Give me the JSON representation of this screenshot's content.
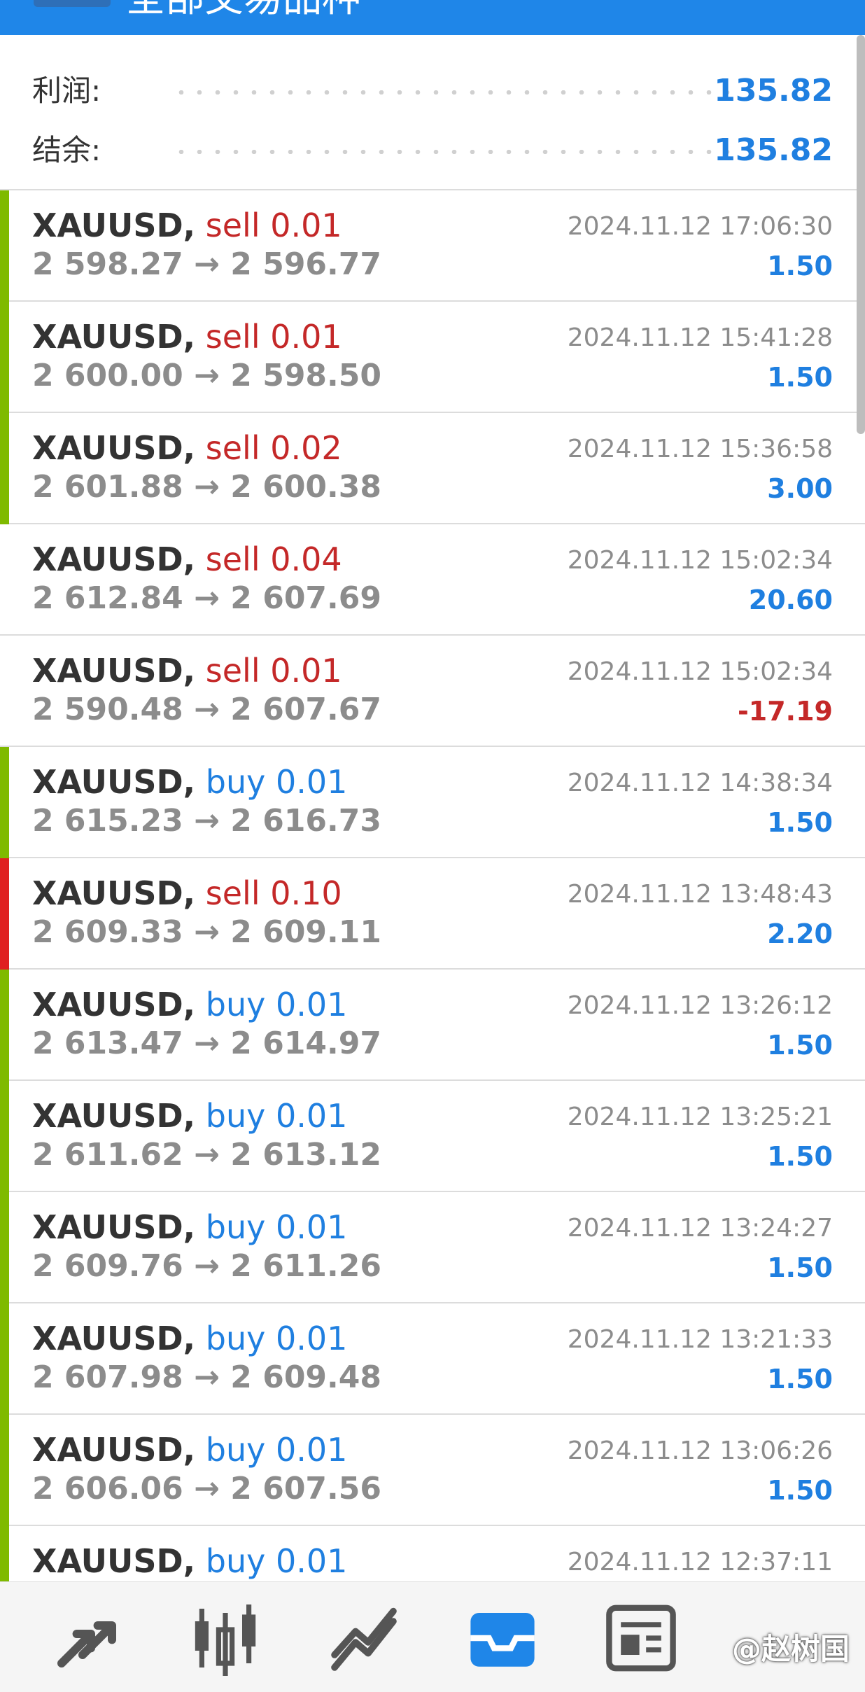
{
  "header": {
    "title": "全部交易品种"
  },
  "summary": {
    "profit_label": "利润:",
    "profit_value": "135.82",
    "balance_label": "结余:",
    "balance_value": "135.82"
  },
  "trades": [
    {
      "symbol": "XAUUSD,",
      "side": "sell",
      "lots": "0.01",
      "open": "2 598.27",
      "arrow": "→",
      "close": "2 596.77",
      "time": "2024.11.12 17:06:30",
      "profit": "1.50",
      "bar_color": "#7fba00",
      "profit_sign": "pos"
    },
    {
      "symbol": "XAUUSD,",
      "side": "sell",
      "lots": "0.01",
      "open": "2 600.00",
      "arrow": "→",
      "close": "2 598.50",
      "time": "2024.11.12 15:41:28",
      "profit": "1.50",
      "bar_color": "#7fba00",
      "profit_sign": "pos"
    },
    {
      "symbol": "XAUUSD,",
      "side": "sell",
      "lots": "0.02",
      "open": "2 601.88",
      "arrow": "→",
      "close": "2 600.38",
      "time": "2024.11.12 15:36:58",
      "profit": "3.00",
      "bar_color": "#7fba00",
      "profit_sign": "pos"
    },
    {
      "symbol": "XAUUSD,",
      "side": "sell",
      "lots": "0.04",
      "open": "2 612.84",
      "arrow": "→",
      "close": "2 607.69",
      "time": "2024.11.12 15:02:34",
      "profit": "20.60",
      "bar_color": "",
      "profit_sign": "pos"
    },
    {
      "symbol": "XAUUSD,",
      "side": "sell",
      "lots": "0.01",
      "open": "2 590.48",
      "arrow": "→",
      "close": "2 607.67",
      "time": "2024.11.12 15:02:34",
      "profit": "-17.19",
      "bar_color": "",
      "profit_sign": "neg"
    },
    {
      "symbol": "XAUUSD,",
      "side": "buy",
      "lots": "0.01",
      "open": "2 615.23",
      "arrow": "→",
      "close": "2 616.73",
      "time": "2024.11.12 14:38:34",
      "profit": "1.50",
      "bar_color": "#7fba00",
      "profit_sign": "pos"
    },
    {
      "symbol": "XAUUSD,",
      "side": "sell",
      "lots": "0.10",
      "open": "2 609.33",
      "arrow": "→",
      "close": "2 609.11",
      "time": "2024.11.12 13:48:43",
      "profit": "2.20",
      "bar_color": "#e02020",
      "profit_sign": "pos"
    },
    {
      "symbol": "XAUUSD,",
      "side": "buy",
      "lots": "0.01",
      "open": "2 613.47",
      "arrow": "→",
      "close": "2 614.97",
      "time": "2024.11.12 13:26:12",
      "profit": "1.50",
      "bar_color": "#7fba00",
      "profit_sign": "pos"
    },
    {
      "symbol": "XAUUSD,",
      "side": "buy",
      "lots": "0.01",
      "open": "2 611.62",
      "arrow": "→",
      "close": "2 613.12",
      "time": "2024.11.12 13:25:21",
      "profit": "1.50",
      "bar_color": "#7fba00",
      "profit_sign": "pos"
    },
    {
      "symbol": "XAUUSD,",
      "side": "buy",
      "lots": "0.01",
      "open": "2 609.76",
      "arrow": "→",
      "close": "2 611.26",
      "time": "2024.11.12 13:24:27",
      "profit": "1.50",
      "bar_color": "#7fba00",
      "profit_sign": "pos"
    },
    {
      "symbol": "XAUUSD,",
      "side": "buy",
      "lots": "0.01",
      "open": "2 607.98",
      "arrow": "→",
      "close": "2 609.48",
      "time": "2024.11.12 13:21:33",
      "profit": "1.50",
      "bar_color": "#7fba00",
      "profit_sign": "pos"
    },
    {
      "symbol": "XAUUSD,",
      "side": "buy",
      "lots": "0.01",
      "open": "2 606.06",
      "arrow": "→",
      "close": "2 607.56",
      "time": "2024.11.12 13:06:26",
      "profit": "1.50",
      "bar_color": "#7fba00",
      "profit_sign": "pos"
    },
    {
      "symbol": "XAUUSD,",
      "side": "buy",
      "lots": "0.01",
      "open": "",
      "arrow": "",
      "close": "",
      "time": "2024.11.12 12:37:11",
      "profit": "",
      "bar_color": "#7fba00",
      "profit_sign": "pos"
    }
  ],
  "bottom_nav": {
    "items": [
      {
        "icon": "quotes-arrows-icon",
        "active": false
      },
      {
        "icon": "candlestick-chart-icon",
        "active": false
      },
      {
        "icon": "trend-chart-icon",
        "active": false
      },
      {
        "icon": "history-inbox-icon",
        "active": true
      },
      {
        "icon": "news-icon",
        "active": false
      }
    ],
    "watermark": "@赵树国"
  },
  "colors": {
    "header_blue": "#1f86e8",
    "accent_blue": "#1f7fe0",
    "sell_red": "#c42828",
    "profit_green_bar": "#7fba00",
    "loss_red_bar": "#e02020",
    "muted_gray": "#8c8c8c",
    "active_nav": "#1f86e8",
    "inactive_nav": "#555555"
  }
}
